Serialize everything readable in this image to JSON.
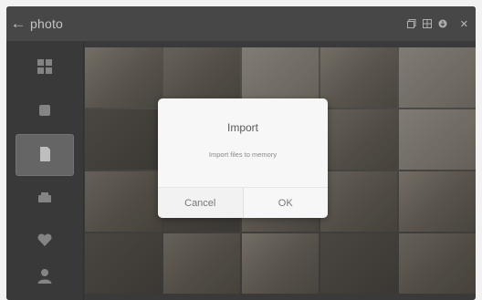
{
  "header": {
    "title": "photo",
    "back_icon": "arrow-left-icon",
    "status_text": "",
    "close_icon": "close-icon"
  },
  "sidebar": {
    "items": [
      {
        "label": "",
        "icon": "photos-icon"
      },
      {
        "label": "",
        "icon": "memory-icon"
      },
      {
        "label": "",
        "icon": "sd-card-icon"
      },
      {
        "label": "",
        "icon": "usb-icon"
      },
      {
        "label": "",
        "icon": "favorites-icon"
      },
      {
        "label": "",
        "icon": "user-icon"
      }
    ]
  },
  "dialog": {
    "title": "Import",
    "message": "Import files to memory",
    "cancel_label": "Cancel",
    "ok_label": "OK"
  },
  "colors": {
    "topbar": "#4b4b4b",
    "sidebar": "#3d3d3d",
    "dialog_bg": "#f7f7f7",
    "active_item": "#6b6b6b"
  }
}
